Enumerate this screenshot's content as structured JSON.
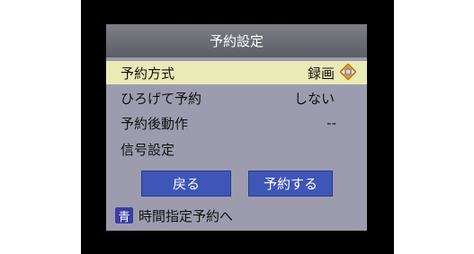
{
  "dialog": {
    "title": "予約設定",
    "rows": [
      {
        "label": "予約方式",
        "value": "録画",
        "selected": true
      },
      {
        "label": "ひろげて予約",
        "value": "しない"
      },
      {
        "label": "予約後動作",
        "value": "--"
      },
      {
        "label": "信号設定",
        "value": ""
      }
    ],
    "buttons": {
      "back": "戻る",
      "reserve": "予約する"
    },
    "footer": {
      "key_label": "青",
      "text": "時間指定予約へ"
    }
  },
  "colors": {
    "dialog_bg": "#9d9cae",
    "title_bg": "#6e6e78",
    "selected_row": "#eaeab6",
    "button_bg": "#3f56b9",
    "key_badge": "#3a3ea0",
    "cursor_icon": "#e39a26"
  },
  "icons": {
    "selector": "left-right-arrow-diamond-icon"
  }
}
